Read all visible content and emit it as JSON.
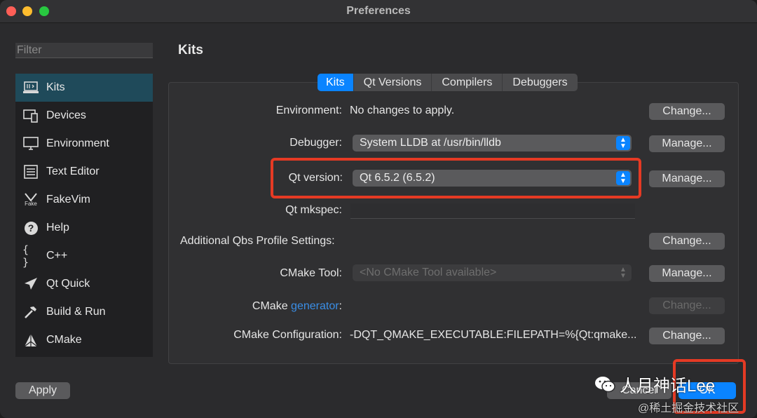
{
  "window": {
    "title": "Preferences"
  },
  "sidebar": {
    "filter_placeholder": "Filter",
    "items": [
      {
        "label": "Kits",
        "icon": "kits-icon",
        "active": true
      },
      {
        "label": "Devices",
        "icon": "devices-icon"
      },
      {
        "label": "Environment",
        "icon": "environment-icon"
      },
      {
        "label": "Text Editor",
        "icon": "text-editor-icon"
      },
      {
        "label": "FakeVim",
        "icon": "fakevim-icon",
        "icon_text": "Fake"
      },
      {
        "label": "Help",
        "icon": "help-icon",
        "icon_text": "?"
      },
      {
        "label": "C++",
        "icon": "braces-icon",
        "icon_text": "{ }"
      },
      {
        "label": "Qt Quick",
        "icon": "paper-plane-icon"
      },
      {
        "label": "Build & Run",
        "icon": "hammer-icon"
      },
      {
        "label": "CMake",
        "icon": "cmake-icon"
      }
    ]
  },
  "main": {
    "title": "Kits",
    "tabs": [
      {
        "label": "Kits",
        "active": true
      },
      {
        "label": "Qt Versions"
      },
      {
        "label": "Compilers"
      },
      {
        "label": "Debuggers"
      }
    ],
    "rows": {
      "environment": {
        "label": "Environment:",
        "value": "No changes to apply.",
        "button": "Change..."
      },
      "debugger": {
        "label": "Debugger:",
        "value": "System LLDB at /usr/bin/lldb",
        "button": "Manage..."
      },
      "qt_version": {
        "label": "Qt version:",
        "value": "Qt 6.5.2 (6.5.2)",
        "button": "Manage..."
      },
      "qt_mkspec": {
        "label": "Qt mkspec:",
        "value": ""
      },
      "qbs": {
        "label": "Additional Qbs Profile Settings:",
        "button": "Change..."
      },
      "cmake_tool": {
        "label": "CMake Tool:",
        "value": "<No CMake Tool available>",
        "button": "Manage..."
      },
      "cmake_generator": {
        "label_prefix": "CMake ",
        "link": "generator",
        "label_suffix": ":",
        "button": "Change..."
      },
      "cmake_config": {
        "label": "CMake Configuration:",
        "value": "-DQT_QMAKE_EXECUTABLE:FILEPATH=%{Qt:qmake...",
        "button": "Change..."
      }
    }
  },
  "footer": {
    "apply": "Apply",
    "cancel": "Cancel",
    "ok": "OK"
  },
  "watermark": {
    "main": "人月神话Lee",
    "sub": "@稀土掘金技术社区"
  },
  "colors": {
    "accent": "#0a84ff",
    "highlight": "#e53a24",
    "sidebar_active": "#1f4a5a"
  }
}
